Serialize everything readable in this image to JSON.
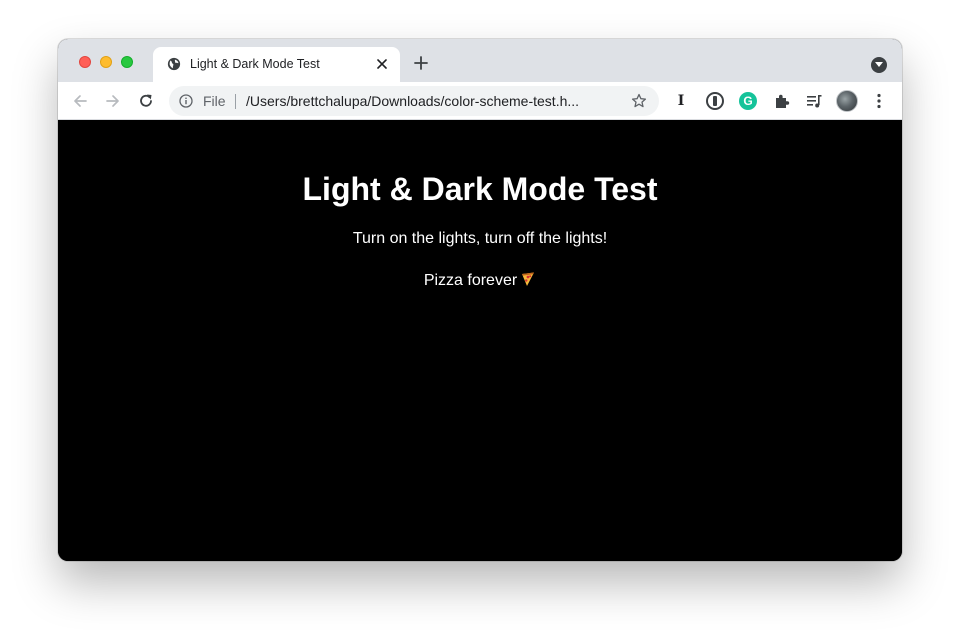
{
  "browser": {
    "tab": {
      "title": "Light & Dark Mode Test",
      "favicon": "globe-icon"
    },
    "omnibox": {
      "scheme_label": "File",
      "url": "/Users/brettchalupa/Downloads/color-scheme-test.h..."
    },
    "extensions": [
      "text-cursor-extension-icon",
      "password-manager-extension-icon",
      "grammarly-extension-icon",
      "puzzle-icon",
      "media-queue-icon"
    ],
    "colors": {
      "tabstrip": "#dee1e6",
      "toolbar": "#ffffff",
      "omnibox": "#f1f3f4",
      "grammarly": "#15c39a"
    }
  },
  "page": {
    "heading": "Light & Dark Mode Test",
    "paragraph_1": "Turn on the lights, turn off the lights!",
    "paragraph_2": "Pizza forever",
    "paragraph_2_emoji": "pizza-icon",
    "colors": {
      "background": "#000000",
      "text": "#ffffff"
    }
  }
}
